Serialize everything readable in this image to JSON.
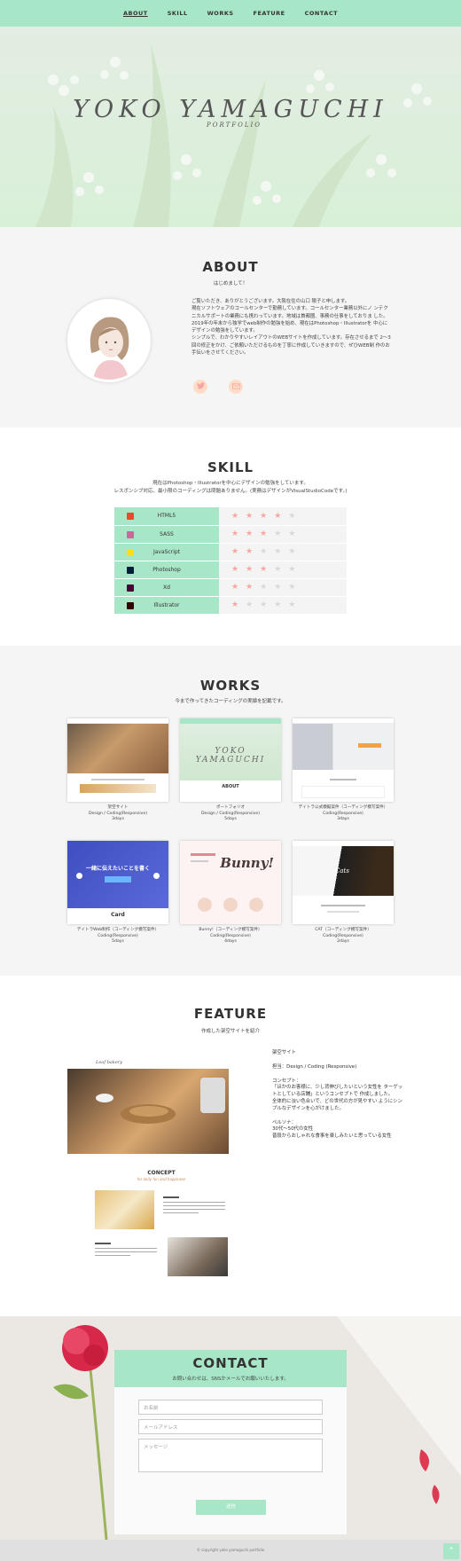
{
  "nav": {
    "items": [
      "ABOUT",
      "SKILL",
      "WORKS",
      "FEATURE",
      "CONTACT"
    ]
  },
  "hero": {
    "title": "YOKO YAMAGUCHI",
    "subtitle": "PORTFOLIO"
  },
  "about": {
    "title": "ABOUT",
    "subtitle": "はじめまして！",
    "text": "ご覧いただき、ありがとうございます。大阪在住の山口 陽子と申します。\n現在ソフトウェアのコールセンターで勤務しています。コールセンター業務以外にノ ンテクニカルサポートの業務にも携わっています。地域は首都圏、事務の仕事をしておりま した。\n2019年の年末から独学でweb制作の勉強を始め、現在はPhotoshop・Illustratorを 中心にデザインの勉強をしています。\nシンプルで、わかりやすいレイアウトのWEBサイトを作成しています。存在させるまで 2〜3回の修正をかけ、ご依頼いただけるものを丁寧に作成していきますので、ぜひWEB制 作のお手伝いをさせてください。"
  },
  "skill": {
    "title": "SKILL",
    "subtitle_line1": "現在はPhotoshop・Illustratorを中心にデザインの勉強をしています。",
    "subtitle_line2": "レスポンシブ対応、最小限のコーディングは問題ありません。(実務はデザインがVisualStudioCodeです。)",
    "rows": [
      {
        "name": "HTML5",
        "stars": 4,
        "icon_color": "#e44d26"
      },
      {
        "name": "SASS",
        "stars": 3,
        "icon_color": "#cd6799"
      },
      {
        "name": "JavaScript",
        "stars": 2,
        "icon_color": "#f7df1e"
      },
      {
        "name": "Photoshop",
        "stars": 3,
        "icon_color": "#001e36"
      },
      {
        "name": "Xd",
        "stars": 2,
        "icon_color": "#470137"
      },
      {
        "name": "Illustrator",
        "stars": 1,
        "icon_color": "#330000"
      }
    ]
  },
  "works": {
    "title": "WORKS",
    "subtitle": "今まで作ってきたコーディングの実績を記載です。",
    "items": [
      {
        "name": "架空サイト",
        "type": "Design / Coding(Responsive)",
        "days": "3days"
      },
      {
        "name": "ポートフォリオ",
        "type": "Design / Coding(Responsive)",
        "days": "5days"
      },
      {
        "name": "デイトラ公式模擬案件（コーディング模写案件）",
        "type": "Coding(Responsive)",
        "days": "3days"
      },
      {
        "name": "デイトラWeb制作（コーディング模写案件）",
        "type": "Coding(Responsive)",
        "days": "5days",
        "thumb_label": "一緒に伝えたいことを書く",
        "thumb_badge": "Card"
      },
      {
        "name": "Bunny!（コーディング模写案件）",
        "type": "Coding(Responsive)",
        "days": "4days",
        "thumb_label": "Bunny!"
      },
      {
        "name": "CAT（コーディング模写案件）",
        "type": "Coding(Responsive)",
        "days": "2days",
        "thumb_label": "Cats"
      }
    ]
  },
  "feature": {
    "title": "FEATURE",
    "subtitle": "作成した架空サイトを紹介",
    "site_name": "架空サイト",
    "role": "担当：Design / Coding (Responsive)",
    "concept_label": "コンセプト：",
    "concept_text": "「ほかのお客様に、少し背伸びしたいという女性を ターゲットとしている店舗」というコンセプトで 作成しました。\n全体的に淡い色合いで、どの世代の方が見やすい ようにシンプルなデザインを心がけました。",
    "persona_label": "ペルソナ：",
    "persona_text": "30代〜50代の女性\n普段からおしゃれな食事を楽しみたいと思っている女性",
    "mock_concept_title": "CONCEPT",
    "mock_concept_sub": "for daily fun and happiness",
    "mock_logo": "Leaf bakery"
  },
  "contact": {
    "title": "CONTACT",
    "subtitle": "お問い合わせは、SNSかメールでお願いいたします。",
    "name_placeholder": "お名前",
    "email_placeholder": "メールアドレス",
    "message_placeholder": "メッセージ",
    "submit_label": "送信"
  },
  "footer": {
    "copyright": "© copyright yoko yamaguchi portfolio"
  },
  "colors": {
    "accent": "#a8e6c8",
    "star": "#f4a7a0",
    "hero_bg": "#dfeee0"
  },
  "icons": {
    "twitter": "twitter-icon",
    "mail": "mail-icon",
    "to_top": "chevron-up-icon"
  }
}
